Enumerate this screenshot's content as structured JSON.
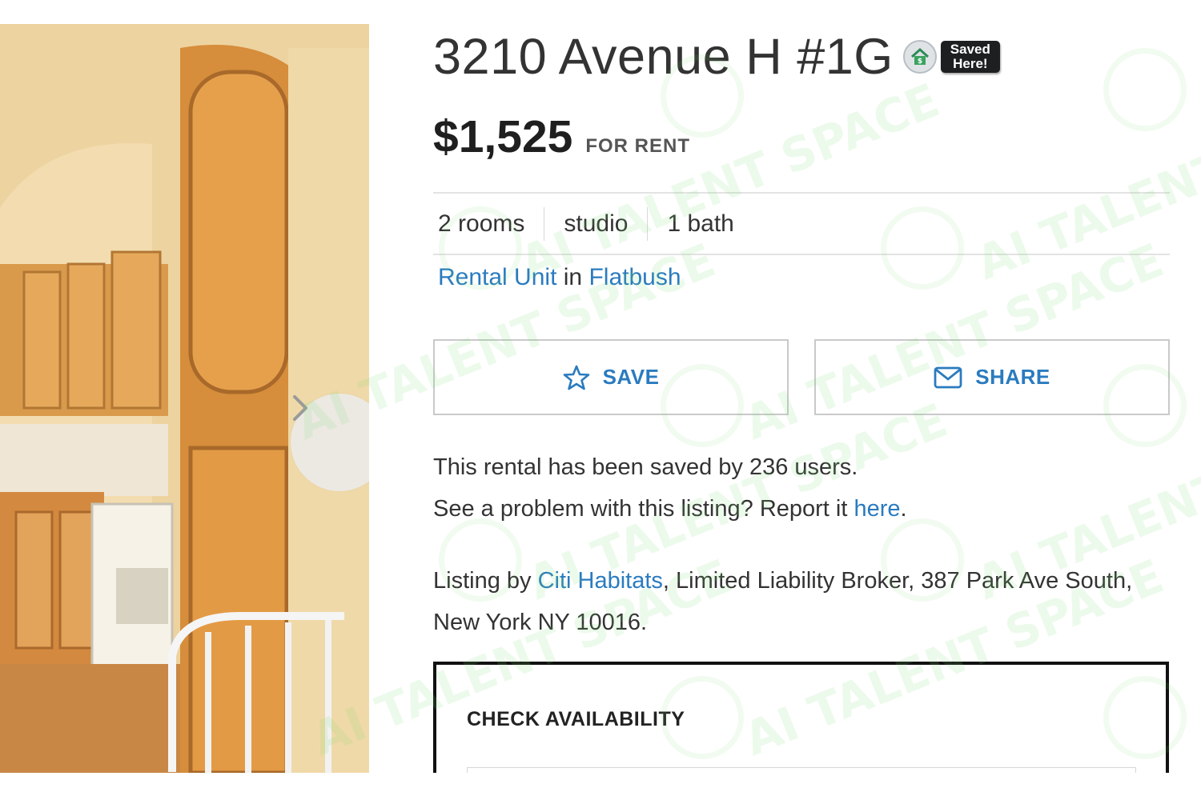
{
  "listing": {
    "address": "3210 Avenue H #1G",
    "price": "$1,525",
    "status": "FOR RENT",
    "facts": [
      "2 rooms",
      "studio",
      "1 bath"
    ],
    "unit_type": "Rental Unit",
    "in_word": "in",
    "neighborhood": "Flatbush"
  },
  "badge": {
    "line1": "Saved",
    "line2": "Here!",
    "icon": "house-dollar-icon"
  },
  "actions": {
    "save_label": "SAVE",
    "save_icon": "star-outline-icon",
    "share_label": "SHARE",
    "share_icon": "envelope-icon"
  },
  "stats": {
    "saved_text": "This rental has been saved by 236 users.",
    "problem_text": "See a problem with this listing? Report it ",
    "report_link": "here",
    "period": "."
  },
  "broker": {
    "prefix": "Listing by ",
    "name": "Citi Habitats",
    "suffix": ", Limited Liability Broker, 387 Park Ave South, New York NY 10016."
  },
  "availability": {
    "title": "CHECK AVAILABILITY"
  },
  "gallery": {
    "next_icon": "chevron-right-icon"
  },
  "watermark": {
    "text": "AI TALENT SPACE"
  },
  "colors": {
    "link": "#2a7bbf",
    "badge_bg": "#1d1f21",
    "watermark": "#78dc6e"
  }
}
